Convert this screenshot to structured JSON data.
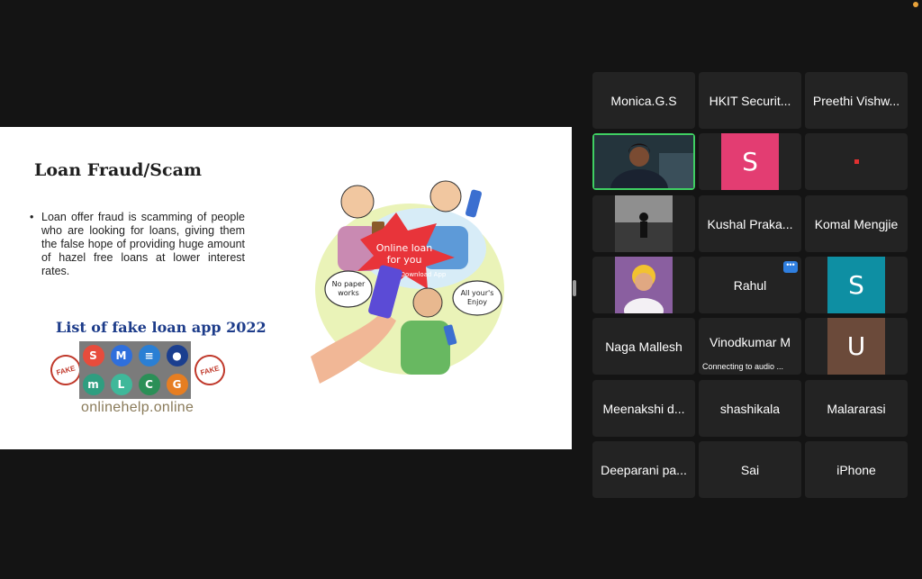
{
  "slide": {
    "title": "Loan Fraud/Scam",
    "bullet": "Loan offer fraud is scamming of people who are looking for loans, giving them the false hope of providing huge amount of hazel free loans at lower interest rates.",
    "fake_apps_title": "List of fake loan app 2022",
    "site": "onlinehelp.online",
    "stamp_text": "FAKE",
    "app_icons": [
      {
        "letter": "S",
        "color": "#e74c3c"
      },
      {
        "letter": "M",
        "color": "#2f6fdc"
      },
      {
        "letter": "≡",
        "color": "#2a7fd4"
      },
      {
        "letter": "●",
        "color": "#1b3f8f"
      },
      {
        "letter": "m",
        "color": "#2f9e80"
      },
      {
        "letter": "L",
        "color": "#3fb89a"
      },
      {
        "letter": "C",
        "color": "#2b8f57"
      },
      {
        "letter": "G",
        "color": "#e67e22"
      }
    ],
    "cartoon": {
      "banner": [
        "Online loan",
        "for you"
      ],
      "download": "Download App",
      "bubble_left": [
        "No paper",
        "works"
      ],
      "bubble_right": [
        "All your's",
        "Enjoy"
      ]
    }
  },
  "participants": [
    {
      "name": "Monica.G.S"
    },
    {
      "name": "HKIT Securit..."
    },
    {
      "name": "Preethi Vishw..."
    },
    {
      "name": "",
      "video": true,
      "active": true
    },
    {
      "avatar_letter": "S",
      "avatar_color": "#e33d72"
    },
    {
      "muted_dot": true
    },
    {
      "photo": "silhouette"
    },
    {
      "name": "Kushal Praka..."
    },
    {
      "name": "Komal Mengjie"
    },
    {
      "photo": "portrait"
    },
    {
      "name": "Rahul",
      "badge": "•••"
    },
    {
      "avatar_letter": "S",
      "avatar_color": "#0e8fa3"
    },
    {
      "name": "Naga Mallesh"
    },
    {
      "name": "Vinodkumar M",
      "status": "Connecting to audio  ..."
    },
    {
      "avatar_letter": "U",
      "avatar_color": "#6b4a3a"
    },
    {
      "name": "Meenakshi d..."
    },
    {
      "name": "shashikala"
    },
    {
      "name": "Malararasi"
    },
    {
      "name": "Deeparani pa..."
    },
    {
      "name": "Sai"
    },
    {
      "name": "iPhone"
    }
  ]
}
